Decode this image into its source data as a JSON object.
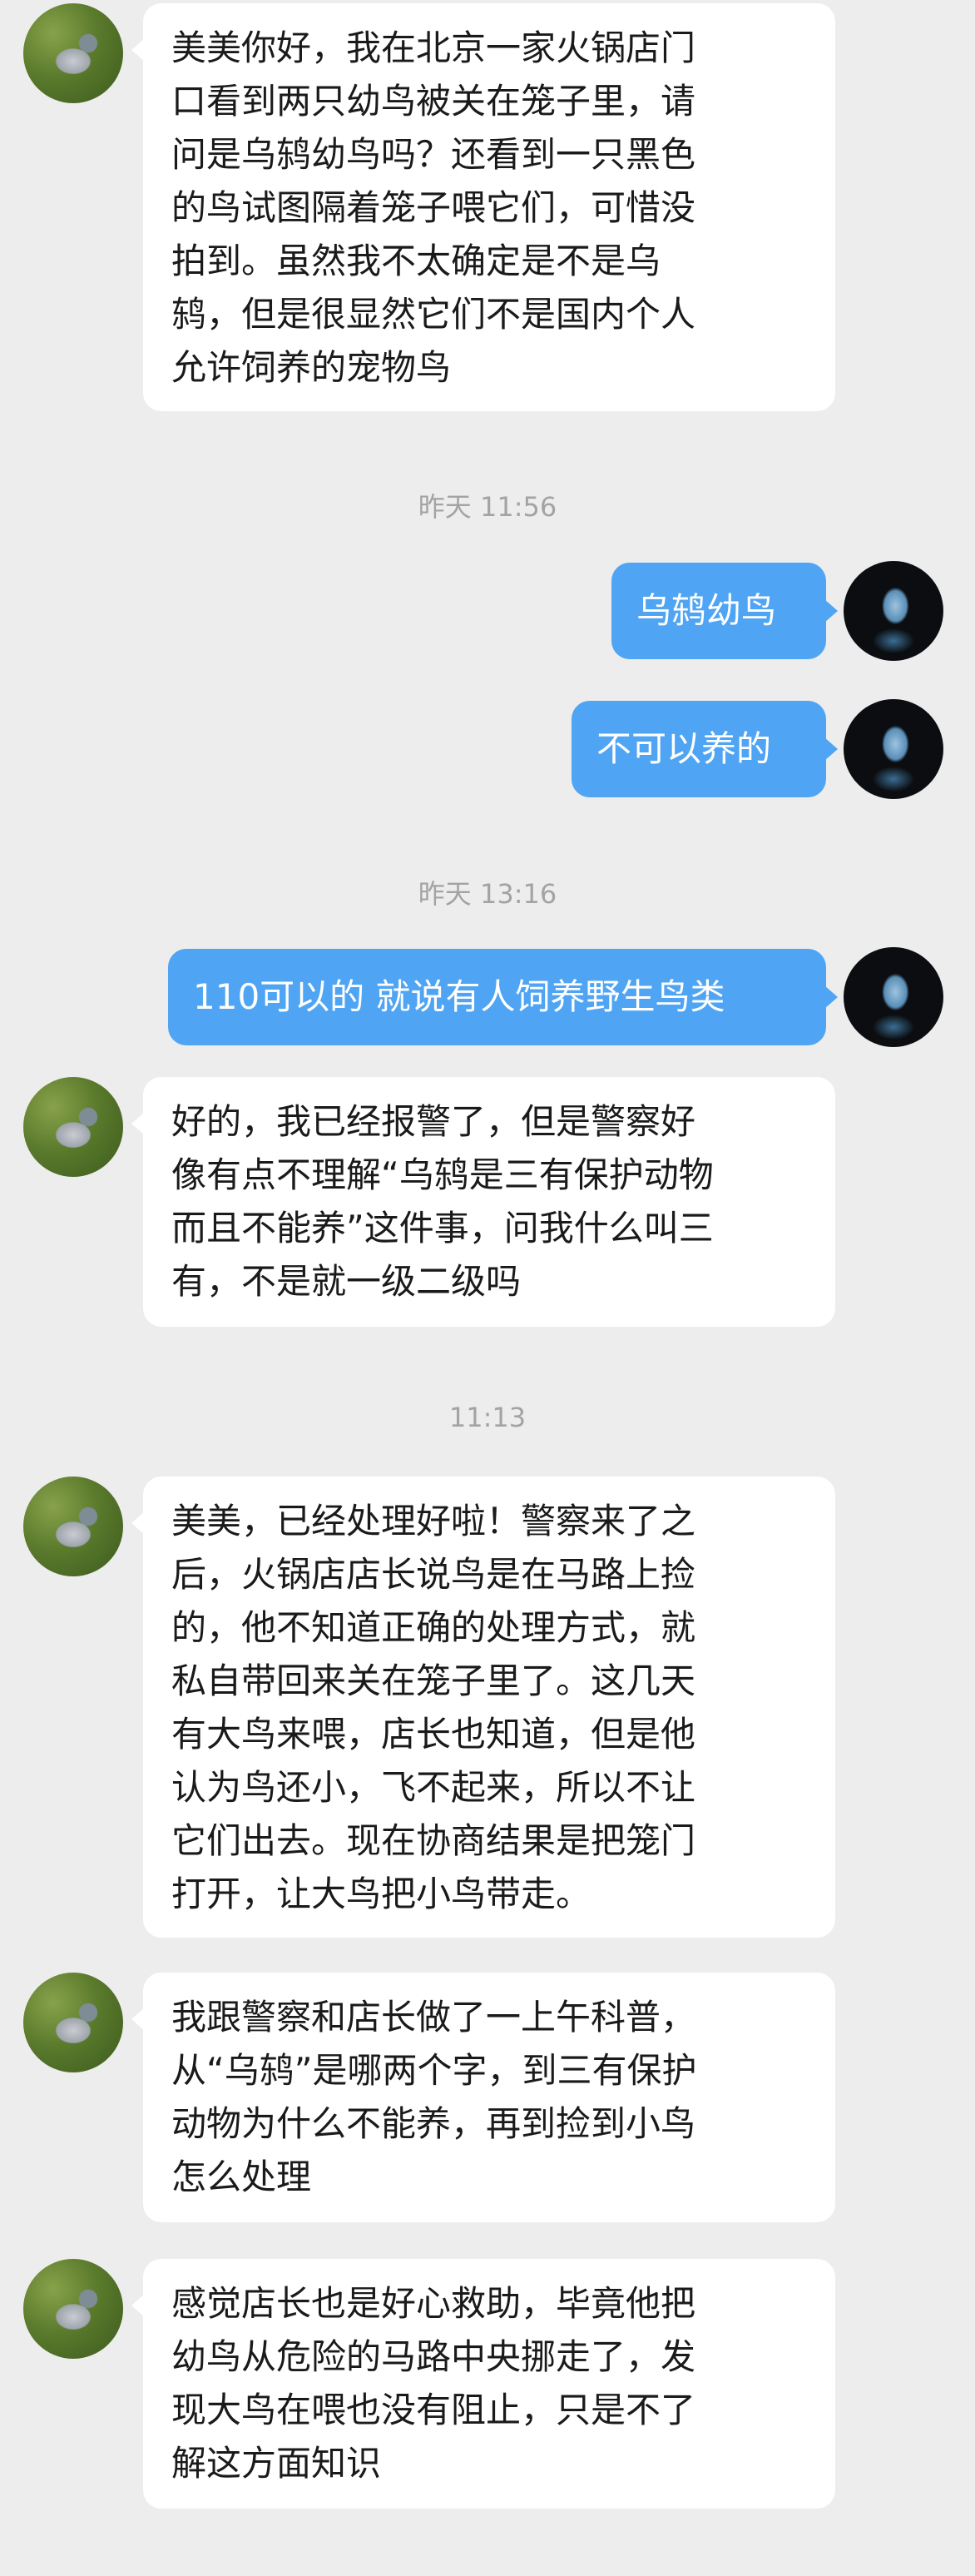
{
  "chat": {
    "messages": [
      {
        "side": "left",
        "avatar": "pigeon-avatar",
        "text": "美美你好，我在北京一家火锅店门\n口看到两只幼鸟被关在笼子里，请\n问是乌鸫幼鸟吗？还看到一只黑色\n的鸟试图隔着笼子喂它们，可惜没\n拍到。虽然我不太确定是不是乌\n鸫，但是很显然它们不是国内个人\n允许饲养的宠物鸟"
      },
      {
        "timestamp": "昨天 11:56"
      },
      {
        "side": "right",
        "avatar": "parrot-avatar",
        "text": "乌鸫幼鸟"
      },
      {
        "side": "right",
        "avatar": "parrot-avatar",
        "text": "不可以养的"
      },
      {
        "timestamp": "昨天 13:16"
      },
      {
        "side": "right",
        "avatar": "parrot-avatar",
        "text": "110可以的 就说有人饲养野生鸟类"
      },
      {
        "side": "left",
        "avatar": "pigeon-avatar",
        "text": "好的，我已经报警了，但是警察好\n像有点不理解“乌鸫是三有保护动物\n而且不能养”这件事，问我什么叫三\n有，不是就一级二级吗"
      },
      {
        "timestamp": "11:13"
      },
      {
        "side": "left",
        "avatar": "pigeon-avatar",
        "text": "美美，已经处理好啦！警察来了之\n后，火锅店店长说鸟是在马路上捡\n的，他不知道正确的处理方式，就\n私自带回来关在笼子里了。这几天\n有大鸟来喂，店长也知道，但是他\n认为鸟还小，飞不起来，所以不让\n它们出去。现在协商结果是把笼门\n打开，让大鸟把小鸟带走。"
      },
      {
        "side": "left",
        "avatar": "pigeon-avatar",
        "text": "我跟警察和店长做了一上午科普，\n从“乌鸫”是哪两个字，到三有保护\n动物为什么不能养，再到捡到小鸟\n怎么处理"
      },
      {
        "side": "left",
        "avatar": "pigeon-avatar",
        "text": "感觉店长也是好心救助，毕竟他把\n幼鸟从危险的马路中央挪走了，发\n现大鸟在喂也没有阻止，只是不了\n解这方面知识"
      }
    ]
  }
}
